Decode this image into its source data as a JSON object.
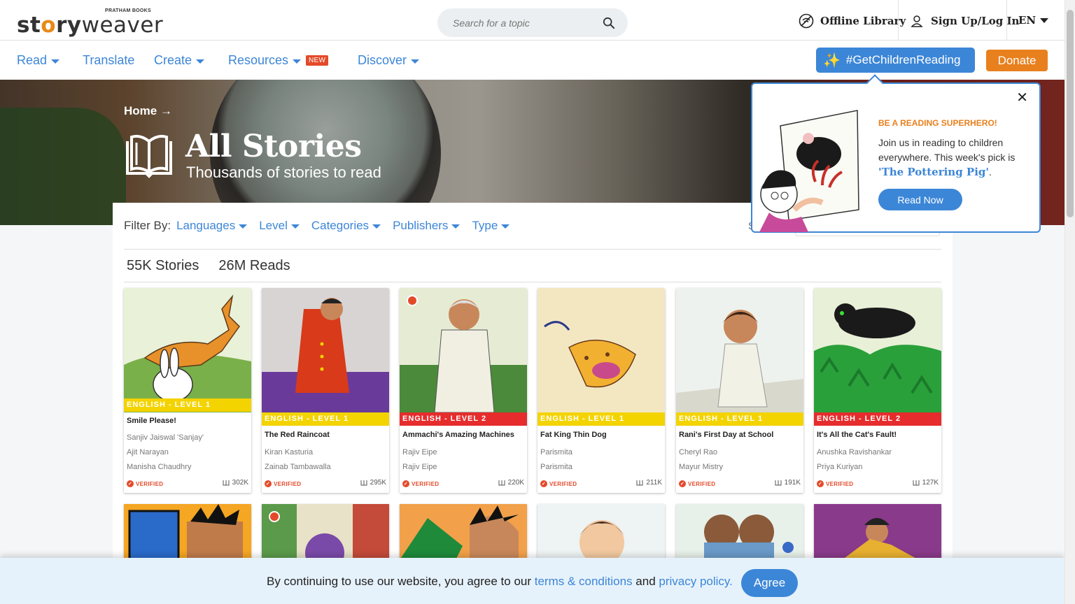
{
  "header": {
    "brand_small": "PRATHAM BOOKS",
    "brand_bold": "st",
    "brand_o": "o",
    "brand_bold2": "ry",
    "brand_light": "weaver",
    "search_placeholder": "Search for a topic",
    "offline_label": "Offline Library",
    "signup_label": "Sign Up/Log In",
    "language": "EN"
  },
  "nav": {
    "items": [
      {
        "label": "Read",
        "dropdown": true
      },
      {
        "label": "Translate",
        "dropdown": false
      },
      {
        "label": "Create",
        "dropdown": true
      },
      {
        "label": "Resources",
        "dropdown": true
      },
      {
        "label": "Discover",
        "dropdown": true
      }
    ],
    "new_badge": "NEW",
    "campaign_label": "#GetChildrenReading",
    "donate_label": "Donate"
  },
  "hero": {
    "breadcrumb": "Home",
    "breadcrumb_arrow": "→",
    "title": "All Stories",
    "subtitle": "Thousands of stories to read"
  },
  "filters": {
    "label": "Filter By:",
    "items": [
      "Languages",
      "Level",
      "Categories",
      "Publishers",
      "Type"
    ],
    "sort_stub": "S"
  },
  "stats": {
    "stories": "55K Stories",
    "reads": "26M Reads"
  },
  "cards": [
    {
      "level": "ENGLISH - LEVEL 1",
      "title": "Smile Please!",
      "authors": [
        "Sanjiv Jaiswal 'Sanjay'",
        "Ajit Narayan",
        "Manisha Chaudhry"
      ],
      "verified": "VERIFIED",
      "reads": "302K",
      "level_color": "#f3d300"
    },
    {
      "level": "ENGLISH - LEVEL 1",
      "title": "The Red Raincoat",
      "authors": [
        "Kiran Kasturia",
        "Zainab Tambawalla"
      ],
      "verified": "VERIFIED",
      "reads": "295K",
      "level_color": "#f3d300"
    },
    {
      "level": "ENGLISH - LEVEL 2",
      "title": "Ammachi's Amazing Machines",
      "authors": [
        "Rajiv Eipe",
        "Rajiv Eipe"
      ],
      "verified": "VERIFIED",
      "reads": "220K",
      "level_color": "#e62c2c"
    },
    {
      "level": "ENGLISH - LEVEL 1",
      "title": "Fat King Thin Dog",
      "authors": [
        "Parismita",
        "Parismita"
      ],
      "verified": "VERIFIED",
      "reads": "211K",
      "level_color": "#f3d300"
    },
    {
      "level": "ENGLISH - LEVEL 1",
      "title": "Rani's First Day at School",
      "authors": [
        "Cheryl Rao",
        "Mayur Mistry"
      ],
      "verified": "VERIFIED",
      "reads": "191K",
      "level_color": "#f3d300"
    },
    {
      "level": "ENGLISH - LEVEL 2",
      "title": "It's All the Cat's Fault!",
      "authors": [
        "Anushka Ravishankar",
        "Priya Kuriyan"
      ],
      "verified": "VERIFIED",
      "reads": "127K",
      "level_color": "#e62c2c"
    }
  ],
  "popup": {
    "kicker": "BE A READING SUPERHERO!",
    "body": "Join us in reading to children everywhere. This week's pick is",
    "pick": "'The Pottering Pig'",
    "pick_suffix": ".",
    "button": "Read Now",
    "close": "✕"
  },
  "cookie": {
    "prefix": "By continuing to use our website, you agree to our ",
    "terms": "terms & conditions",
    "middle": " and ",
    "privacy": "privacy policy.",
    "agree": "Agree"
  },
  "colors": {
    "accent": "#3c86d7",
    "donate": "#e8801e",
    "level1": "#f3d300",
    "level2": "#e62c2c",
    "verified": "#e44a2a"
  }
}
